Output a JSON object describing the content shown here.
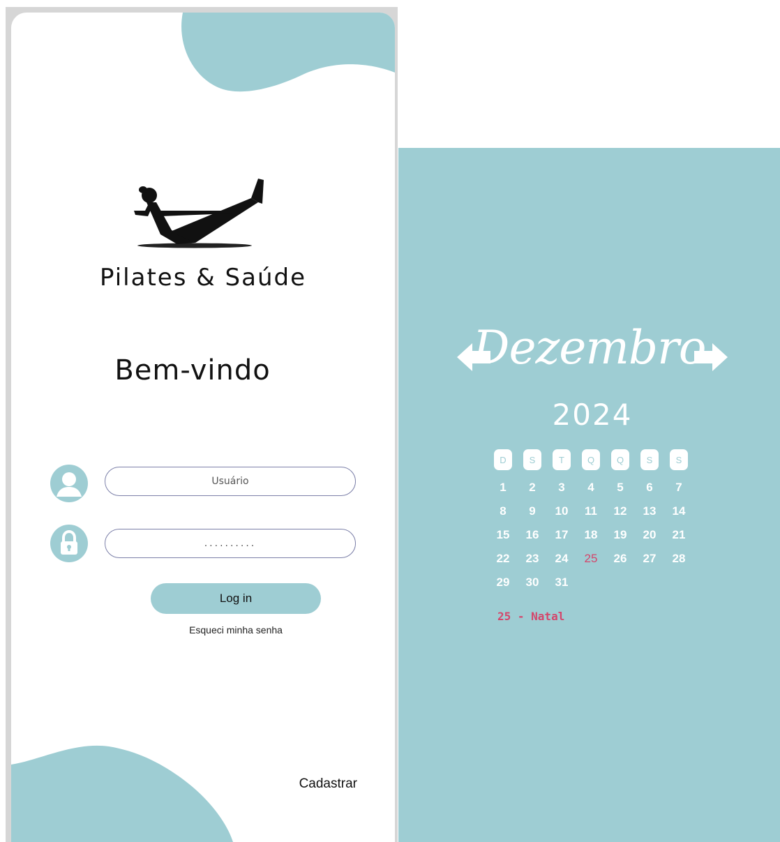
{
  "login": {
    "brand_name": "Pilates & Saúde",
    "welcome_title": "Bem-vindo",
    "username_placeholder": "Usuário",
    "password_value": "..........",
    "login_button_label": "Log in",
    "forgot_password_label": "Esqueci minha senha",
    "signup_label": "Cadastrar",
    "icons": {
      "user": "user-icon",
      "password": "lock-icon"
    },
    "colors": {
      "accent": "#9ecdd3",
      "text": "#111111",
      "input_border": "#7b7fa8"
    }
  },
  "calendar": {
    "month": "Dezembro",
    "year": "2024",
    "prev_icon": "arrow-left-icon",
    "next_icon": "arrow-right-icon",
    "weekdays": [
      "D",
      "S",
      "T",
      "Q",
      "Q",
      "S",
      "S"
    ],
    "weeks": [
      [
        "1",
        "2",
        "3",
        "4",
        "5",
        "6",
        "7"
      ],
      [
        "8",
        "9",
        "10",
        "11",
        "12",
        "13",
        "14"
      ],
      [
        "15",
        "16",
        "17",
        "18",
        "19",
        "20",
        "21"
      ],
      [
        "22",
        "23",
        "24",
        "25",
        "26",
        "27",
        "28"
      ],
      [
        "29",
        "30",
        "31",
        "",
        "",
        "",
        ""
      ]
    ],
    "holiday_day": "25",
    "holiday_note": "25 - Natal",
    "colors": {
      "background": "#9ecdd3",
      "day_text": "#ffffff",
      "holiday": "#d4466b"
    }
  }
}
